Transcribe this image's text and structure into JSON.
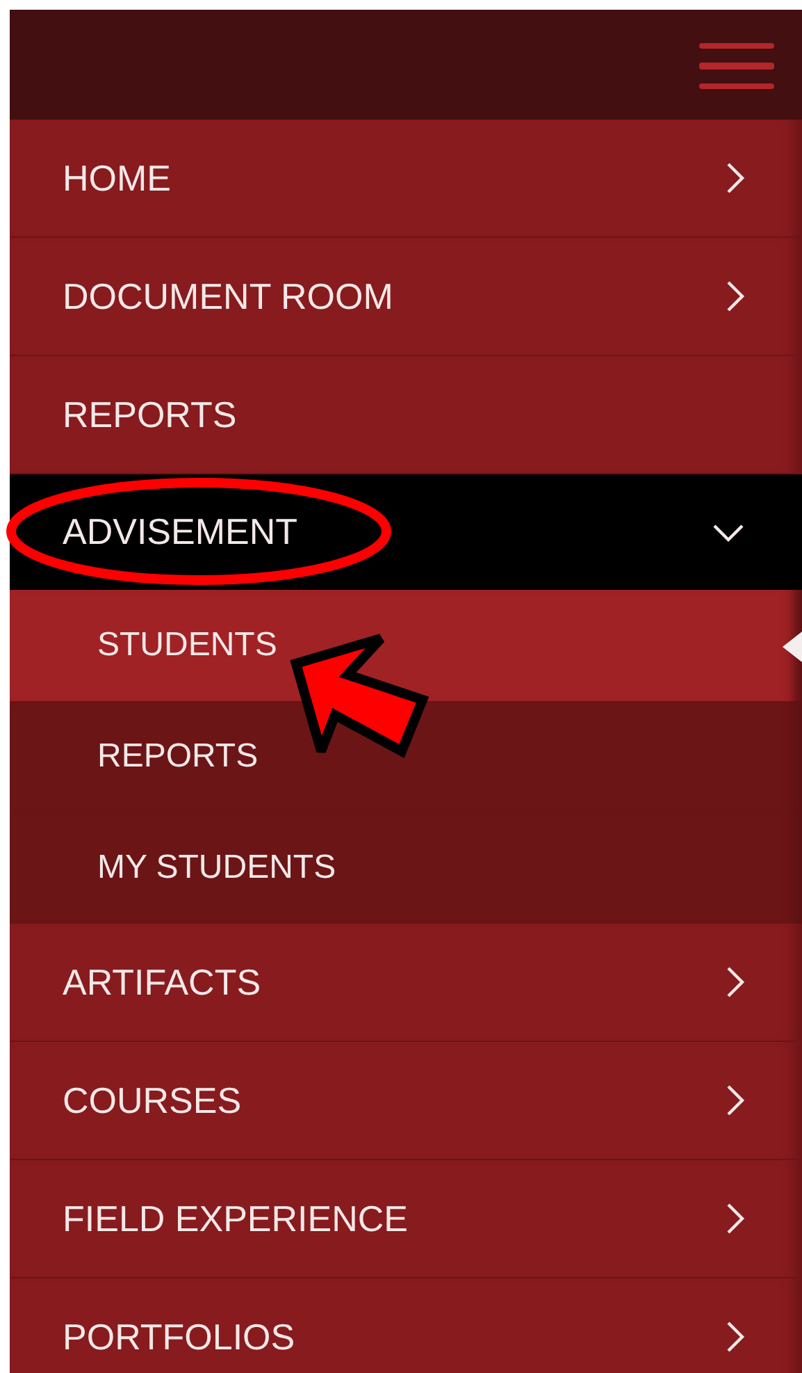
{
  "menu_items": [
    {
      "label": "HOME",
      "kind": "link",
      "circled": false
    },
    {
      "label": "DOCUMENT ROOM",
      "kind": "link",
      "circled": false
    },
    {
      "label": "REPORTS",
      "kind": "plain",
      "circled": false
    },
    {
      "label": "ADVISEMENT",
      "kind": "group",
      "expanded": true,
      "circled": true,
      "children": [
        {
          "label": "STUDENTS",
          "selected": true,
          "arrowed": true
        },
        {
          "label": "REPORTS",
          "selected": false,
          "arrowed": false
        },
        {
          "label": "MY STUDENTS",
          "selected": false,
          "arrowed": false
        }
      ]
    },
    {
      "label": "ARTIFACTS",
      "kind": "link",
      "circled": false
    },
    {
      "label": "COURSES",
      "kind": "link",
      "circled": false
    },
    {
      "label": "FIELD EXPERIENCE",
      "kind": "link",
      "circled": false
    },
    {
      "label": "PORTFOLIOS",
      "kind": "link",
      "circled": false
    }
  ]
}
